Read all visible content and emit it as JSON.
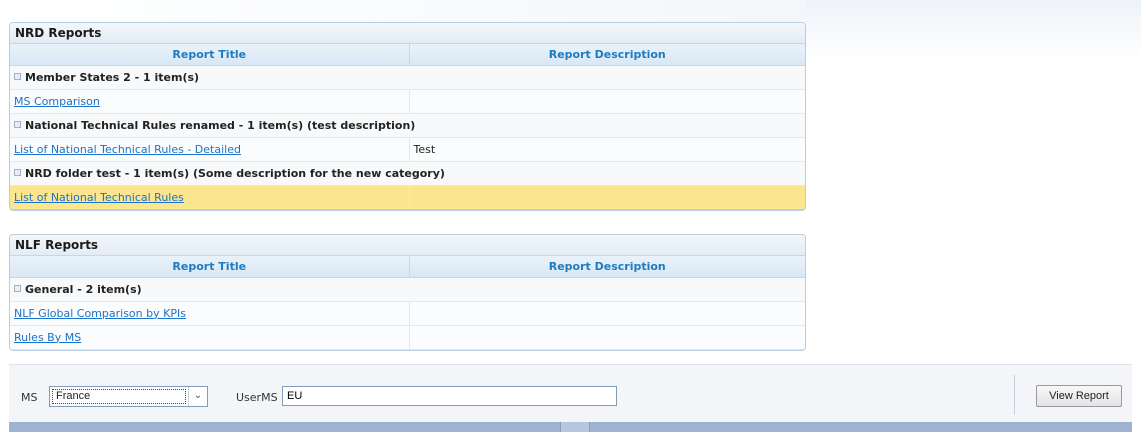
{
  "nrd": {
    "title": "NRD Reports",
    "columns": {
      "title": "Report Title",
      "description": "Report Description"
    },
    "groups": [
      {
        "label": "Member States 2 - 1 item(s)",
        "reports": [
          {
            "title": "MS Comparison",
            "description": ""
          }
        ]
      },
      {
        "label": "National Technical Rules renamed - 1 item(s) (test description)",
        "reports": [
          {
            "title": "List of National Technical Rules - Detailed",
            "description": "Test"
          }
        ]
      },
      {
        "label": "NRD folder test - 1 item(s) (Some description for the new category)",
        "reports": [
          {
            "title": "List of National Technical Rules",
            "description": ""
          }
        ]
      }
    ]
  },
  "nlf": {
    "title": "NLF Reports",
    "columns": {
      "title": "Report Title",
      "description": "Report Description"
    },
    "groups": [
      {
        "label": "General - 2 item(s)",
        "reports": [
          {
            "title": "NLF Global Comparison by KPIs",
            "description": ""
          },
          {
            "title": "Rules By MS",
            "description": ""
          }
        ]
      }
    ]
  },
  "params": {
    "ms_label": "MS",
    "ms_value": "France",
    "userms_label": "UserMS",
    "userms_value": "EU",
    "view_report_label": "View Report"
  },
  "icons": {
    "collapse": "collapse-minus-icon",
    "dropdown": "chevron-down-icon"
  },
  "colors": {
    "link": "#1a73c9",
    "header_text": "#1f7bbf",
    "selected_row": "#fbe58e",
    "border": "#b8cfe3"
  }
}
